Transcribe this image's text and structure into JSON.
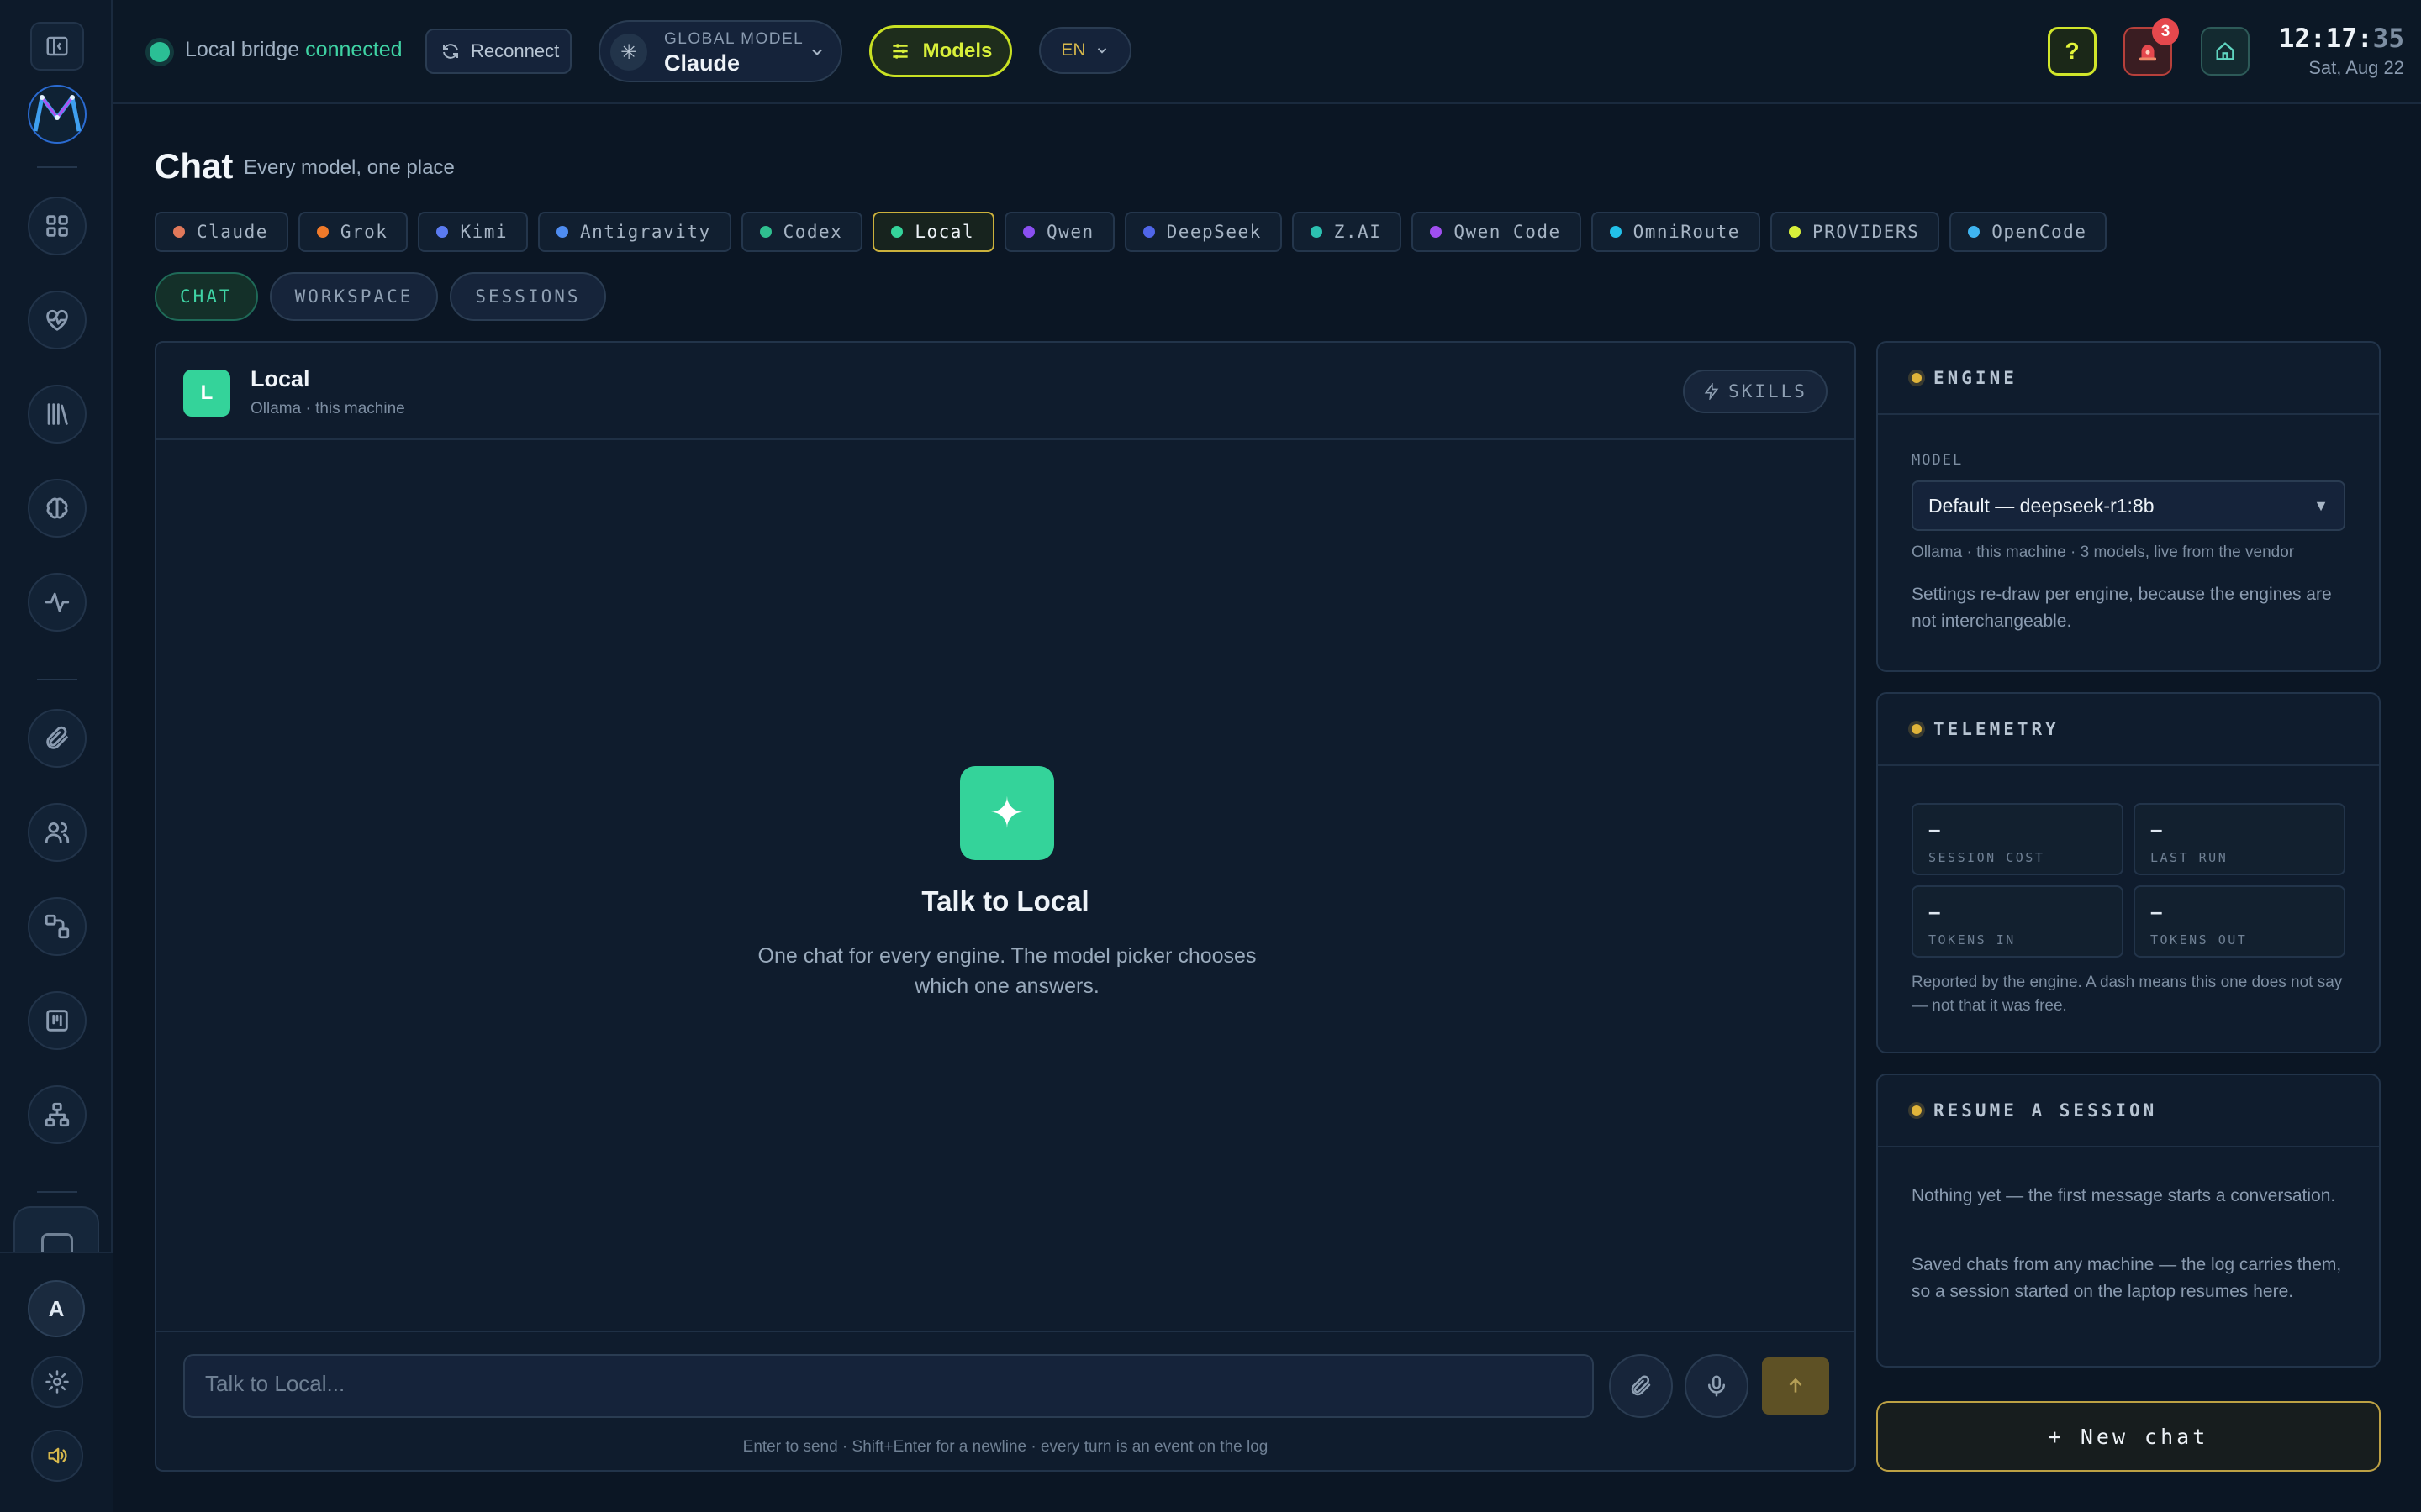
{
  "topbar": {
    "bridge_label": "Local bridge",
    "bridge_status": "connected",
    "reconnect_label": "Reconnect",
    "global_model_label": "GLOBAL MODEL",
    "global_model_value": "Claude",
    "models_label": "Models",
    "language": "EN",
    "help_label": "?",
    "alerts_count": "3",
    "clock_hm": "12:17:",
    "clock_sec": "35",
    "date": "Sat, Aug 22"
  },
  "header": {
    "title": "Chat",
    "subtitle": "Every model, one place"
  },
  "engines": [
    {
      "label": "Claude",
      "color": "#e0785a",
      "active": false
    },
    {
      "label": "Grok",
      "color": "#f07a2a",
      "active": false
    },
    {
      "label": "Kimi",
      "color": "#5b7bf0",
      "active": false
    },
    {
      "label": "Antigravity",
      "color": "#4f8cf0",
      "active": false
    },
    {
      "label": "Codex",
      "color": "#2fbf8f",
      "active": false
    },
    {
      "label": "Local",
      "color": "#34d39a",
      "active": true
    },
    {
      "label": "Qwen",
      "color": "#8a4ff0",
      "active": false
    },
    {
      "label": "DeepSeek",
      "color": "#5066e8",
      "active": false
    },
    {
      "label": "Z.AI",
      "color": "#2cc0b0",
      "active": false
    },
    {
      "label": "Qwen Code",
      "color": "#a04ff0",
      "active": false
    },
    {
      "label": "OmniRoute",
      "color": "#22c0e8",
      "active": false
    },
    {
      "label": "PROVIDERS",
      "color": "#d8ef3a",
      "active": false
    },
    {
      "label": "OpenCode",
      "color": "#3fb4f0",
      "active": false
    }
  ],
  "sub_tabs": [
    {
      "label": "CHAT",
      "active": true
    },
    {
      "label": "WORKSPACE",
      "active": false
    },
    {
      "label": "SESSIONS",
      "active": false
    }
  ],
  "chat": {
    "avatar_letter": "L",
    "name": "Local",
    "meta": "Ollama · this machine",
    "skills_label": "SKILLS",
    "empty_title": "Talk to Local",
    "empty_desc": "One chat for every engine. The model picker chooses which one answers.",
    "input_placeholder": "Talk to Local...",
    "input_value": "",
    "hint": "Enter to send · Shift+Enter for a newline · every turn is an event on the log"
  },
  "engine_card": {
    "title": "ENGINE",
    "model_label": "MODEL",
    "model_value": "Default — deepseek-r1:8b",
    "model_meta": "Ollama · this machine · 3 models, live from the vendor",
    "note": "Settings re-draw per engine, because the engines are not interchangeable."
  },
  "telemetry_card": {
    "title": "TELEMETRY",
    "stats": [
      {
        "value": "–",
        "label": "SESSION COST"
      },
      {
        "value": "–",
        "label": "LAST RUN"
      },
      {
        "value": "–",
        "label": "TOKENS IN"
      },
      {
        "value": "–",
        "label": "TOKENS OUT"
      }
    ],
    "note": "Reported by the engine. A dash means this one does not say — not that it was free."
  },
  "resume_card": {
    "title": "RESUME A SESSION",
    "empty": "Nothing yet — the first message starts a conversation.",
    "note": "Saved chats from any machine — the log carries them, so a session started on the laptop resumes here."
  },
  "new_chat_label": "+ New chat",
  "sidebar": {
    "user_initial": "A",
    "icons": [
      "panel-toggle-icon",
      "grid-icon",
      "heart-pulse-icon",
      "library-icon",
      "brain-icon",
      "activity-icon",
      "paperclip-icon",
      "users-icon",
      "workflow-icon",
      "kanban-icon",
      "sitemap-icon"
    ]
  }
}
